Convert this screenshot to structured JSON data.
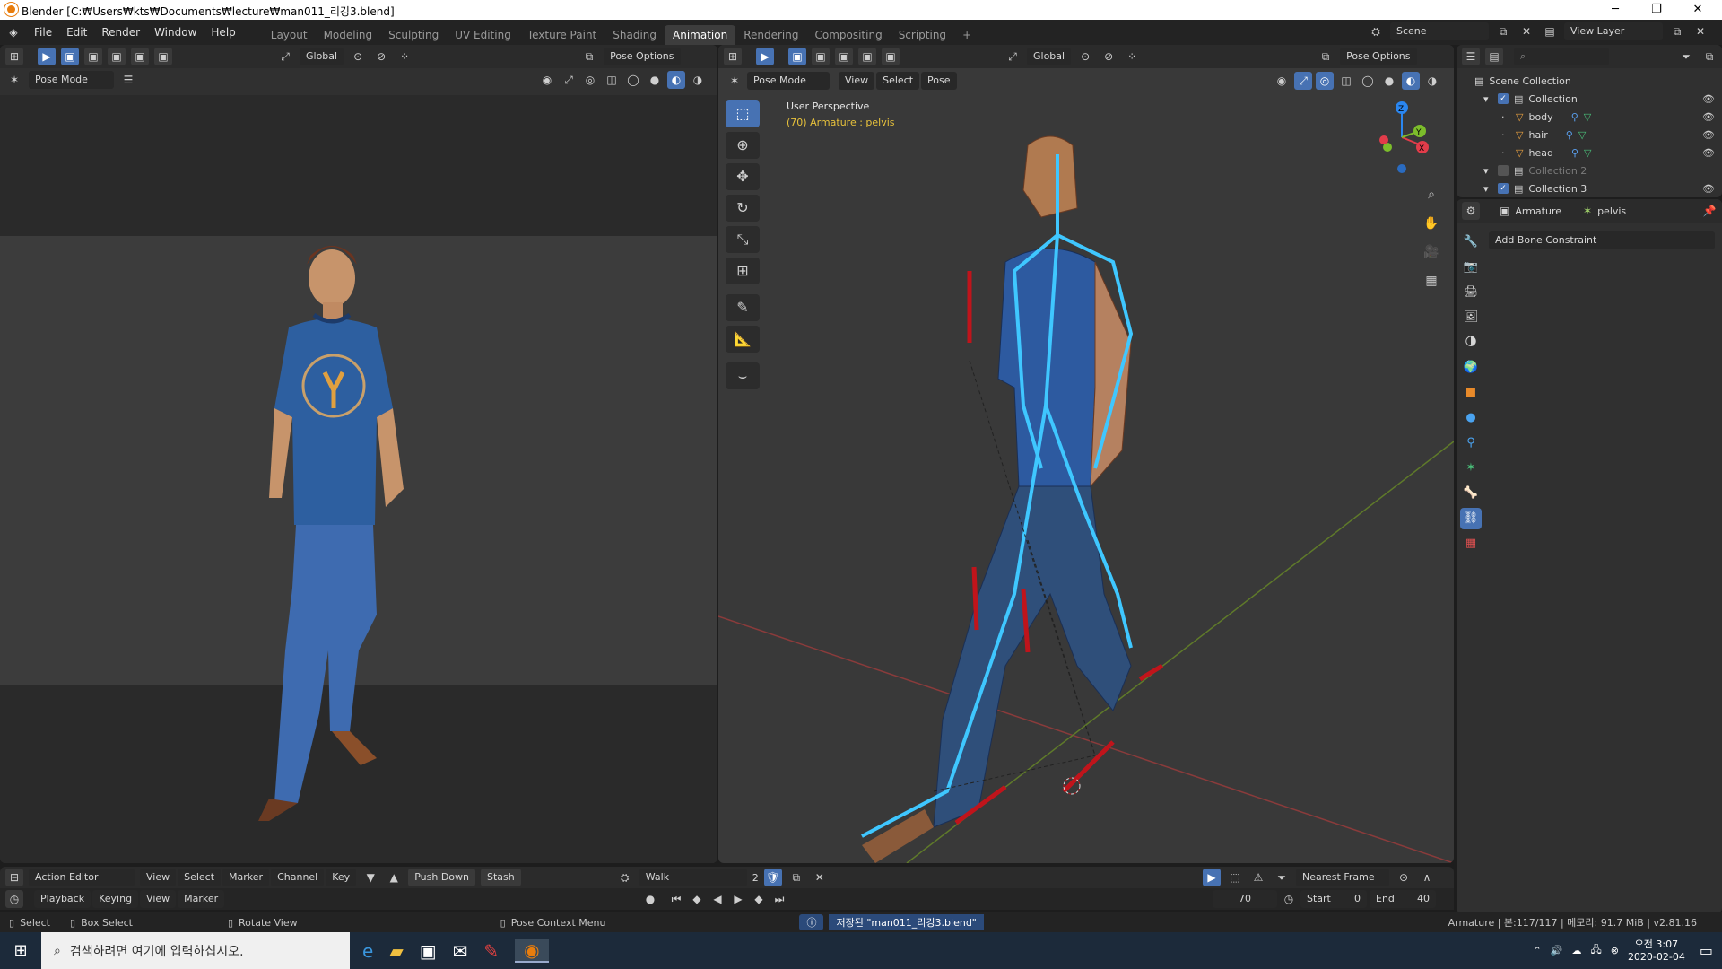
{
  "window": {
    "title": "Blender [C:₩Users₩kts₩Documents₩lecture₩man011_리깅3.blend]",
    "minimize": "─",
    "maximize": "❐",
    "close": "✕"
  },
  "menubar": {
    "menus": [
      "File",
      "Edit",
      "Render",
      "Window",
      "Help"
    ],
    "workspaces": [
      "Layout",
      "Modeling",
      "Sculpting",
      "UV Editing",
      "Texture Paint",
      "Shading",
      "Animation",
      "Rendering",
      "Compositing",
      "Scripting"
    ],
    "active_workspace": "Animation",
    "add_workspace": "+",
    "scene_label": "Scene",
    "view_layer_label": "View Layer"
  },
  "left_viewport": {
    "orientation": "Global",
    "pose_options": "Pose Options",
    "mode": "Pose Mode"
  },
  "main_viewport": {
    "orientation": "Global",
    "pose_options": "Pose Options",
    "mode": "Pose Mode",
    "menus": [
      "View",
      "Select",
      "Pose"
    ],
    "perspective_label": "User Perspective",
    "active_info": "(70) Armature : pelvis",
    "axes": {
      "x": "X",
      "y": "Y",
      "z": "Z"
    }
  },
  "outliner": {
    "search_placeholder": "",
    "scene_collection": "Scene Collection",
    "items": [
      {
        "label": "Collection",
        "level": 1,
        "checked": true,
        "visible": true
      },
      {
        "label": "body",
        "level": 2,
        "checked": false,
        "visible": true
      },
      {
        "label": "hair",
        "level": 2,
        "checked": false,
        "visible": true
      },
      {
        "label": "head",
        "level": 2,
        "checked": false,
        "visible": true
      },
      {
        "label": "Collection 2",
        "level": 1,
        "checked": false,
        "visible": false
      },
      {
        "label": "Collection 3",
        "level": 1,
        "checked": true,
        "visible": true
      }
    ]
  },
  "properties": {
    "object_name": "Armature",
    "bone_name": "pelvis",
    "add_constraint": "Add Bone Constraint"
  },
  "dopesheet": {
    "editor_type": "Action Editor",
    "menus": [
      "View",
      "Select",
      "Marker",
      "Channel",
      "Key"
    ],
    "push_down": "Push Down",
    "stash": "Stash",
    "action_name": "Walk",
    "action_users": "2",
    "snap_mode": "Nearest Frame"
  },
  "timeline": {
    "menus": [
      "Playback",
      "Keying",
      "View",
      "Marker"
    ],
    "current_frame": "70",
    "start_label": "Start",
    "start_value": "0",
    "end_label": "End",
    "end_value": "40"
  },
  "statusbar": {
    "select": "Select",
    "box_select": "Box Select",
    "rotate_view": "Rotate View",
    "context_menu": "Pose Context Menu",
    "saved_message": "저장된 \"man011_리깅3.blend\"",
    "stats": "Armature | 본:117/117 | 메모리: 91.7 MiB | v2.81.16"
  },
  "taskbar": {
    "search_placeholder": "검색하려면 여기에 입력하십시오.",
    "time": "오전 3:07",
    "date": "2020-02-04"
  }
}
